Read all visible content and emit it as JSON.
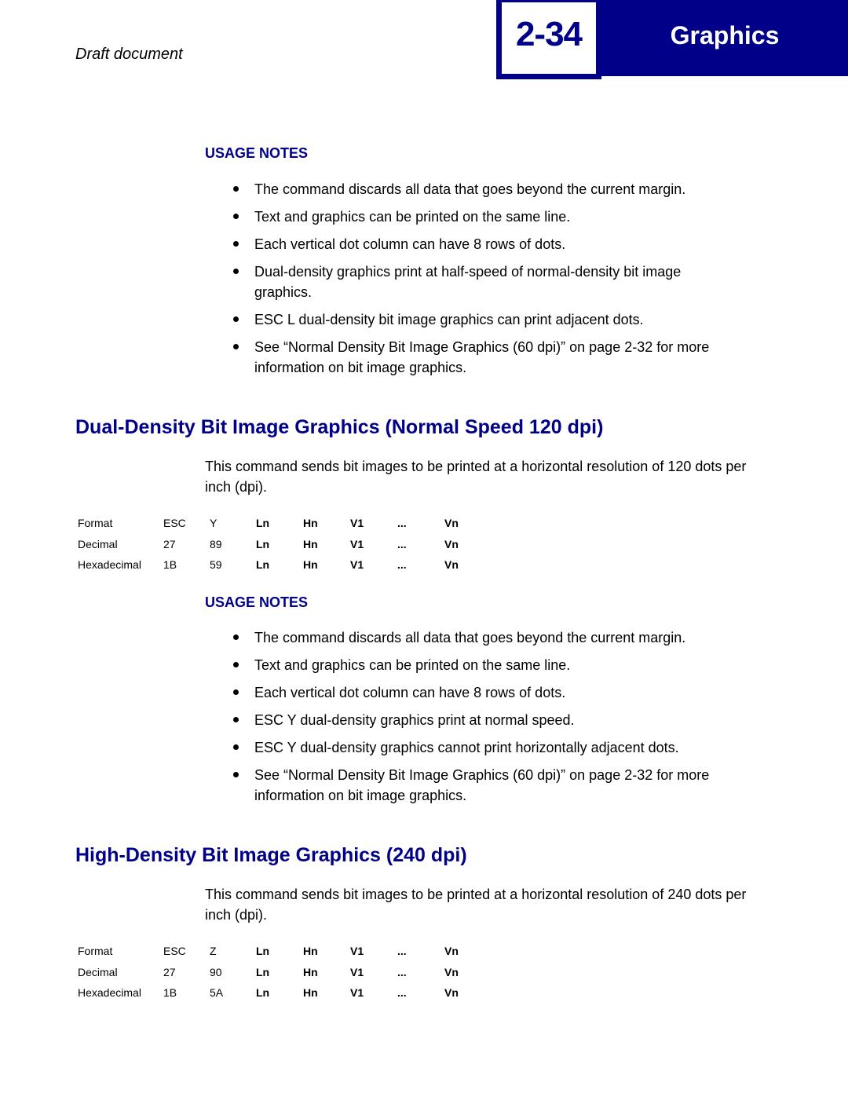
{
  "header": {
    "page_number": "2-34",
    "chapter_title": "Graphics",
    "draft_label": "Draft document",
    "accent_color": "#000088"
  },
  "section0": {
    "usage_notes_label": "USAGE NOTES",
    "notes": [
      "The command discards all data that goes beyond the current margin.",
      "Text and graphics can be printed on the same line.",
      "Each vertical dot column can have 8 rows of dots.",
      "Dual-density graphics print at half-speed of normal-density bit image graphics.",
      "ESC L dual-density bit image graphics can print adjacent dots.",
      "See “Normal Density Bit Image Graphics (60 dpi)” on page 2-32 for more information on bit image graphics."
    ]
  },
  "section1": {
    "heading": "Dual-Density Bit Image Graphics (Normal Speed 120 dpi)",
    "intro": "This command sends bit images to be printed at a horizontal resolution of 120 dots per inch (dpi).",
    "command_table": [
      [
        "Format",
        "ESC",
        "Y",
        "Ln",
        "Hn",
        "V1",
        "...",
        "Vn"
      ],
      [
        "Decimal",
        "27",
        "89",
        "Ln",
        "Hn",
        "V1",
        "...",
        "Vn"
      ],
      [
        "Hexadecimal",
        "1B",
        "59",
        "Ln",
        "Hn",
        "V1",
        "...",
        "Vn"
      ]
    ],
    "usage_notes_label": "USAGE NOTES",
    "notes": [
      "The command discards all data that goes beyond the current margin.",
      "Text and graphics can be printed on the same line.",
      "Each vertical dot column can have 8 rows of dots.",
      "ESC Y dual-density graphics print at normal speed.",
      "ESC Y dual-density graphics cannot print horizontally adjacent dots.",
      "See “Normal Density Bit Image Graphics (60 dpi)” on page 2-32 for more information on bit image graphics."
    ]
  },
  "section2": {
    "heading": "High-Density Bit Image Graphics (240 dpi)",
    "intro": "This command sends bit images to be printed at a horizontal resolution of 240 dots per inch (dpi).",
    "command_table": [
      [
        "Format",
        "ESC",
        "Z",
        "Ln",
        "Hn",
        "V1",
        "...",
        "Vn"
      ],
      [
        "Decimal",
        "27",
        "90",
        "Ln",
        "Hn",
        "V1",
        "...",
        "Vn"
      ],
      [
        "Hexadecimal",
        "1B",
        "5A",
        "Ln",
        "Hn",
        "V1",
        "...",
        "Vn"
      ]
    ]
  }
}
